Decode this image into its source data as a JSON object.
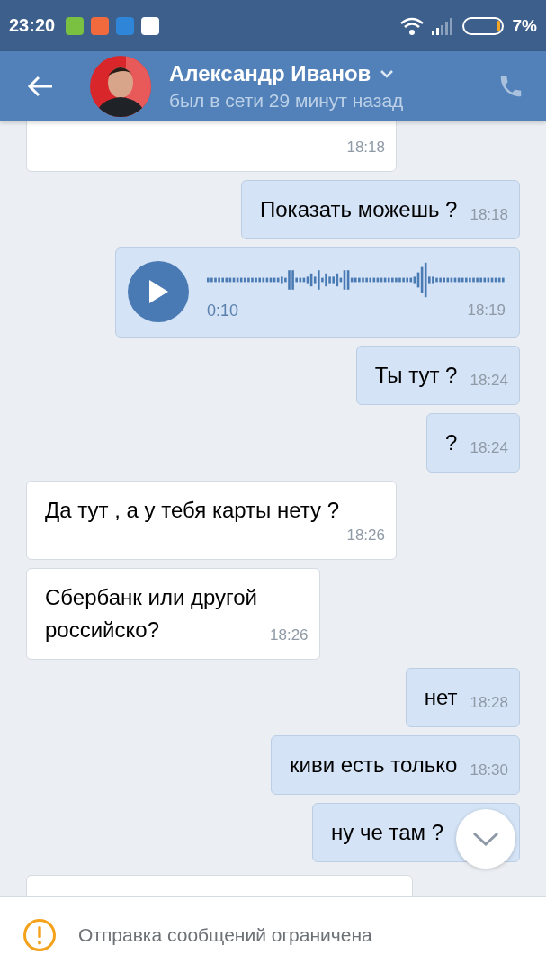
{
  "status_bar": {
    "time": "23:20",
    "battery": "7%"
  },
  "header": {
    "name": "Александр Иванов",
    "status": "был в сети 29 минут назад"
  },
  "messages": [
    {
      "kind": "clipped",
      "outgoing": false,
      "time": "18:18"
    },
    {
      "kind": "text",
      "outgoing": true,
      "text": "Показать можешь ?",
      "time": "18:18"
    },
    {
      "kind": "voice",
      "outgoing": true,
      "duration": "0:10",
      "time": "18:19"
    },
    {
      "kind": "text",
      "outgoing": true,
      "text": "Ты тут ?",
      "time": "18:24"
    },
    {
      "kind": "text",
      "outgoing": true,
      "text": "?",
      "time": "18:24"
    },
    {
      "kind": "text",
      "outgoing": false,
      "text": "Да тут , а у тебя карты нету ?",
      "time": "18:26"
    },
    {
      "kind": "text",
      "outgoing": false,
      "text": "Сбербанк или другой\nроссийско?",
      "time": "18:26"
    },
    {
      "kind": "text",
      "outgoing": true,
      "text": "нет",
      "time": "18:28"
    },
    {
      "kind": "text",
      "outgoing": true,
      "text": "киви есть только",
      "time": "18:30"
    },
    {
      "kind": "text",
      "outgoing": true,
      "text": "ну че там ?"
    },
    {
      "kind": "partial",
      "outgoing": false
    }
  ],
  "notice": {
    "text": "Отправка сообщений ограничена"
  }
}
